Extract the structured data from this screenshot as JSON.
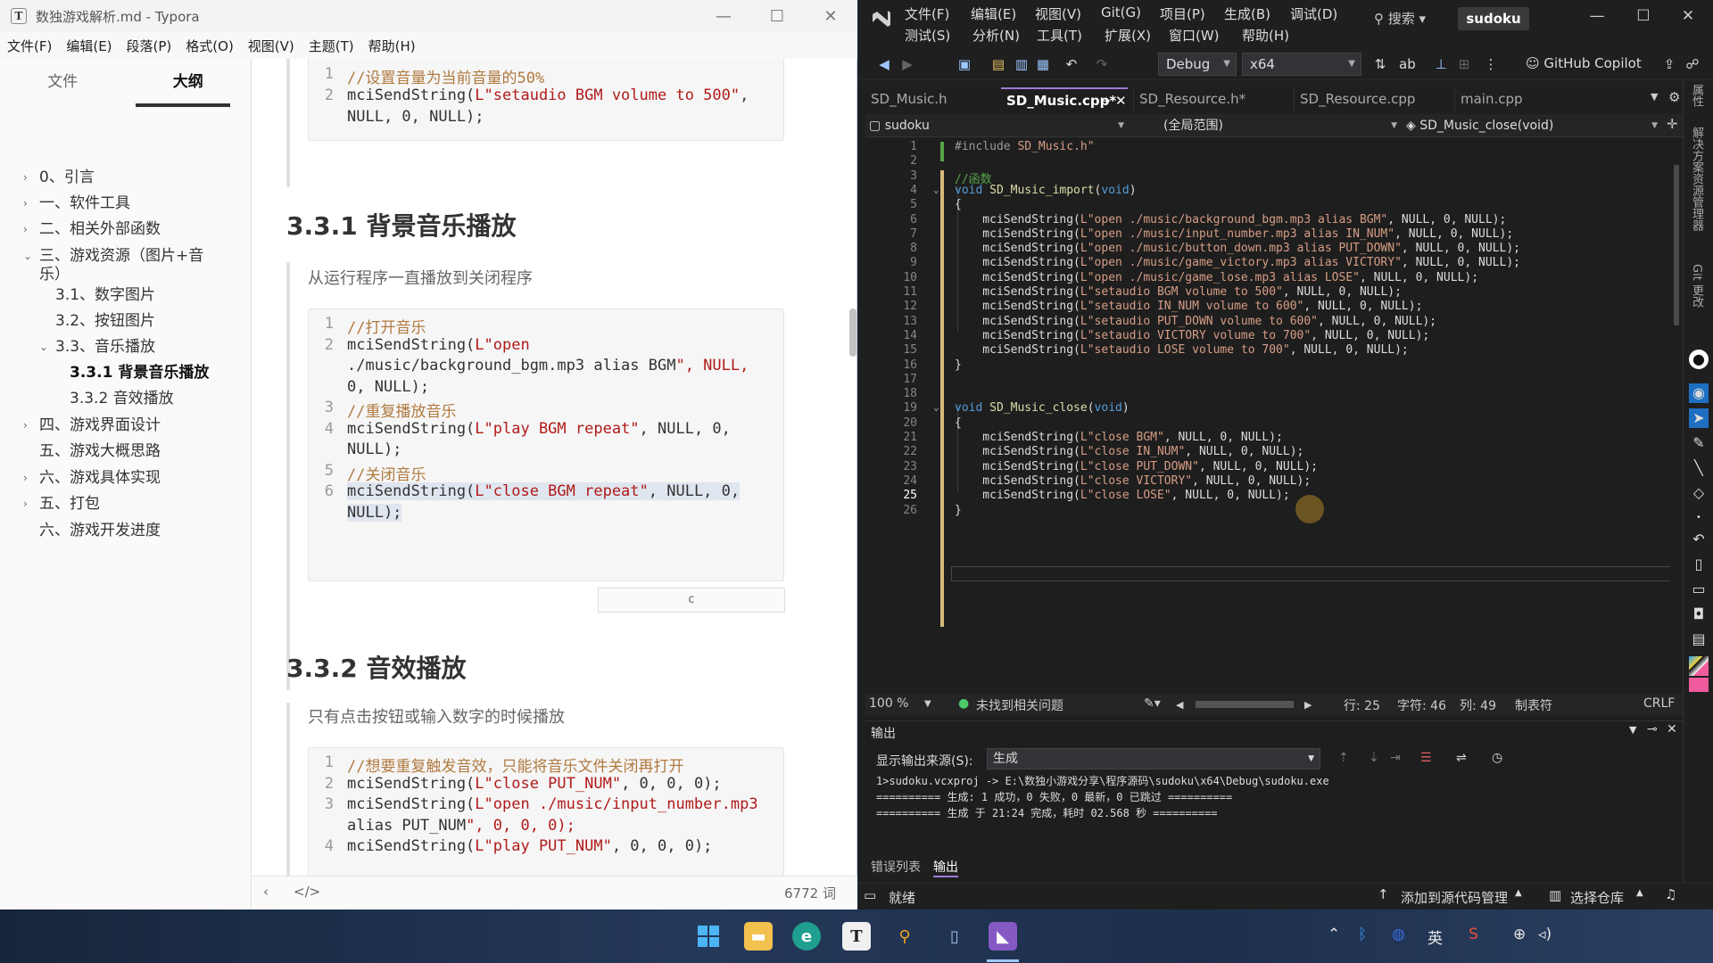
{
  "typora": {
    "title": "数独游戏解析.md - Typora",
    "menu": [
      "文件(F)",
      "编辑(E)",
      "段落(P)",
      "格式(O)",
      "视图(V)",
      "主题(T)",
      "帮助(H)"
    ],
    "sidebar_tabs": [
      "文件",
      "大纲"
    ],
    "outline": [
      {
        "label": "0、引言",
        "chev": "›"
      },
      {
        "label": "一、软件工具",
        "chev": "›"
      },
      {
        "label": "二、相关外部函数",
        "chev": "›"
      },
      {
        "label": "三、游戏资源（图片+音",
        "chev": "⌄"
      },
      {
        "label": "乐）",
        "chev": ""
      },
      {
        "label": "3.1、数字图片",
        "chev": ""
      },
      {
        "label": "3.2、按钮图片",
        "chev": ""
      },
      {
        "label": "3.3、音乐播放",
        "chev": "⌄"
      },
      {
        "label": "3.3.1 背景音乐播放",
        "chev": ""
      },
      {
        "label": "3.3.2 音效播放",
        "chev": ""
      },
      {
        "label": "四、游戏界面设计",
        "chev": "›"
      },
      {
        "label": "五、游戏大概思路",
        "chev": ""
      },
      {
        "label": "六、游戏具体实现",
        "chev": "›"
      },
      {
        "label": "五、打包",
        "chev": "›"
      },
      {
        "label": "六、游戏开发进度",
        "chev": ""
      }
    ],
    "block1": [
      {
        "n": "1",
        "t": "//设置音量为当前音量的50%"
      },
      {
        "n": "2",
        "t": "mciSendString(L\"setaudio BGM volume to 500\","
      },
      {
        "n": "",
        "t": "NULL, 0, NULL);"
      }
    ],
    "heading1": "3.3.1 背景音乐播放",
    "quote1": "从运行程序一直播放到关闭程序",
    "block2": [
      {
        "n": "1",
        "t": "//打开音乐"
      },
      {
        "n": "2",
        "t": "mciSendString(L\"open"
      },
      {
        "n": "",
        "t": "./music/background_bgm.mp3 alias BGM\", NULL,"
      },
      {
        "n": "",
        "t": "0, NULL);"
      },
      {
        "n": "3",
        "t": "//重复播放音乐"
      },
      {
        "n": "4",
        "t": "mciSendString(L\"play BGM repeat\", NULL, 0,"
      },
      {
        "n": "",
        "t": "NULL);"
      },
      {
        "n": "5",
        "t": "//关闭音乐"
      },
      {
        "n": "6",
        "t": "mciSendString(L\"close BGM repeat\", NULL, 0,"
      },
      {
        "n": "",
        "t": "NULL);"
      }
    ],
    "lang_label": "c",
    "heading2": "3.3.2 音效播放",
    "quote2": "只有点击按钮或输入数字的时候播放",
    "block3": [
      {
        "n": "1",
        "t": "//想要重复触发音效，只能将音乐文件关闭再打开"
      },
      {
        "n": "2",
        "t": "mciSendString(L\"close PUT_NUM\", 0, 0, 0);"
      },
      {
        "n": "3",
        "t": "mciSendString(L\"open ./music/input_number.mp3"
      },
      {
        "n": "",
        "t": "alias PUT_NUM\", 0, 0, 0);"
      },
      {
        "n": "4",
        "t": "mciSendString(L\"play PUT_NUM\", 0, 0, 0);"
      }
    ],
    "word_count": "6772 词",
    "status_left": "‹",
    "status_code": "</>"
  },
  "vs": {
    "menu_row1": [
      "文件(F)",
      "编辑(E)",
      "视图(V)",
      "Git(G)",
      "项目(P)",
      "生成(B)",
      "调试(D)"
    ],
    "menu_row2": [
      "测试(S)",
      "分析(N)",
      "工具(T)",
      "扩展(X)",
      "窗口(W)",
      "帮助(H)"
    ],
    "search": "搜索",
    "solution": "sudoku",
    "config": "Debug",
    "platform": "x64",
    "copilot": "GitHub Copilot",
    "tabs": [
      "SD_Music.h",
      "SD_Music.cpp*",
      "SD_Resource.h*",
      "SD_Resource.cpp",
      "main.cpp"
    ],
    "nav_project": "sudoku",
    "nav_scope": "(全局范围)",
    "nav_func": "SD_Music_close(void)",
    "code": [
      "#include \"SD_Music.h\"",
      "",
      "//函数",
      "void SD_Music_import(void)",
      "{",
      "    mciSendString(L\"open ./music/background_bgm.mp3 alias BGM\", NULL, 0, NULL);",
      "    mciSendString(L\"open ./music/input_number.mp3 alias IN_NUM\", NULL, 0, NULL);",
      "    mciSendString(L\"open ./music/button_down.mp3 alias PUT_DOWN\", NULL, 0, NULL);",
      "    mciSendString(L\"open ./music/game_victory.mp3 alias VICTORY\", NULL, 0, NULL);",
      "    mciSendString(L\"open ./music/game_lose.mp3 alias LOSE\", NULL, 0, NULL);",
      "    mciSendString(L\"setaudio BGM volume to 500\", NULL, 0, NULL);",
      "    mciSendString(L\"setaudio IN_NUM volume to 600\", NULL, 0, NULL);",
      "    mciSendString(L\"setaudio PUT_DOWN volume to 600\", NULL, 0, NULL);",
      "    mciSendString(L\"setaudio VICTORY volume to 700\", NULL, 0, NULL);",
      "    mciSendString(L\"setaudio LOSE volume to 700\", NULL, 0, NULL);",
      "}",
      "",
      "",
      "void SD_Music_close(void)",
      "{",
      "    mciSendString(L\"close BGM\", NULL, 0, NULL);",
      "    mciSendString(L\"close IN_NUM\", NULL, 0, NULL);",
      "    mciSendString(L\"close PUT_DOWN\", NULL, 0, NULL);",
      "    mciSendString(L\"close VICTORY\", NULL, 0, NULL);",
      "    mciSendString(L\"close LOSE\", NULL, 0, NULL);",
      "}"
    ],
    "edstatus": {
      "zoom": "100 %",
      "issues": "未找到相关问题",
      "line": "行: 25",
      "char": "字符: 46",
      "col": "列: 49",
      "tab": "制表符",
      "eol": "CRLF"
    },
    "output": {
      "title": "输出",
      "source_label": "显示输出来源(S):",
      "source_value": "生成",
      "lines": [
        "1>sudoku.vcxproj -> E:\\数独小游戏分享\\程序源码\\sudoku\\x64\\Debug\\sudoku.exe",
        "========== 生成: 1 成功，0 失败，0 最新，0 已跳过 ==========",
        "========== 生成 于 21:24 完成，耗时 02.568 秒 =========="
      ],
      "tabs": [
        "错误列表",
        "输出"
      ]
    },
    "statusbar": {
      "ready": "就绪",
      "source_control": "添加到源代码管理",
      "repo": "选择仓库"
    },
    "rail": [
      "属性",
      "解决方案资源管理器",
      "Git 更改"
    ]
  },
  "taskbar": {
    "ime": "英"
  },
  "colors": {
    "vs_bg": "#1e1e1e",
    "vs_keyword": "#569cd6",
    "vs_string": "#d69d85",
    "vs_comment": "#57a64a",
    "typora_string": "#b11a1a",
    "typora_comment": "#b07a40"
  }
}
